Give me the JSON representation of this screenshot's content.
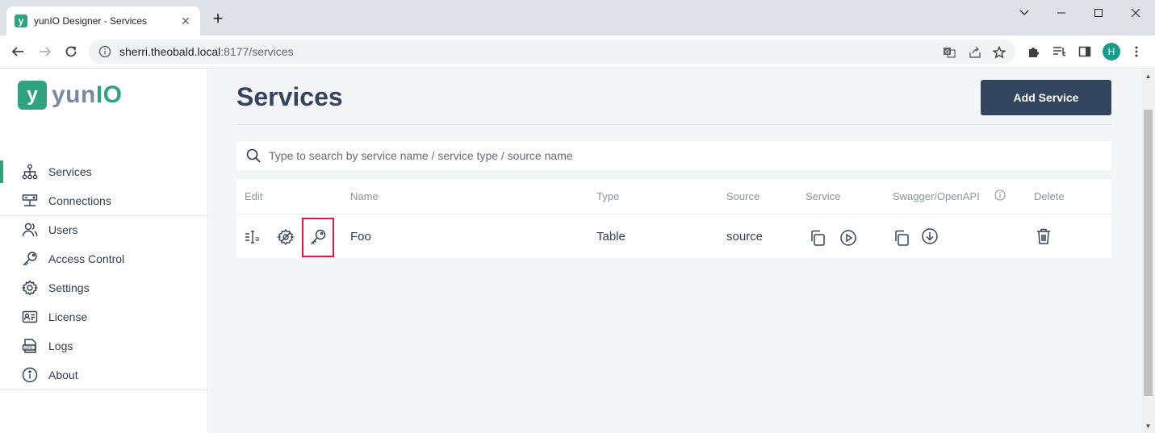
{
  "browser": {
    "tab_title": "yunIO Designer - Services",
    "url_host": "sherri.theobald.local",
    "url_rest": ":8177/services",
    "profile_initial": "H"
  },
  "app": {
    "logo_prefix": "yun",
    "logo_suffix": "IO",
    "page_title": "Services",
    "add_button": "Add Service",
    "search_placeholder": "Type to search by service name / service type / source name"
  },
  "sidebar": {
    "items": [
      {
        "label": "Services",
        "icon": "sitemap-icon",
        "active": true
      },
      {
        "label": "Connections",
        "icon": "server-icon"
      },
      {
        "label": "Users",
        "icon": "users-icon"
      },
      {
        "label": "Access Control",
        "icon": "key-icon"
      },
      {
        "label": "Settings",
        "icon": "gear-icon"
      },
      {
        "label": "License",
        "icon": "id-card-icon"
      },
      {
        "label": "Logs",
        "icon": "logs-icon"
      },
      {
        "label": "About",
        "icon": "info-icon"
      }
    ]
  },
  "table": {
    "headers": {
      "edit": "Edit",
      "name": "Name",
      "type": "Type",
      "source": "Source",
      "service": "Service",
      "swagger": "Swagger/OpenAPI",
      "delete": "Delete"
    },
    "rows": [
      {
        "name": "Foo",
        "type": "Table",
        "source": "source"
      }
    ]
  },
  "colors": {
    "brand": "#2ea37e",
    "primary_button": "#34455f",
    "highlight": "#e0193f"
  }
}
